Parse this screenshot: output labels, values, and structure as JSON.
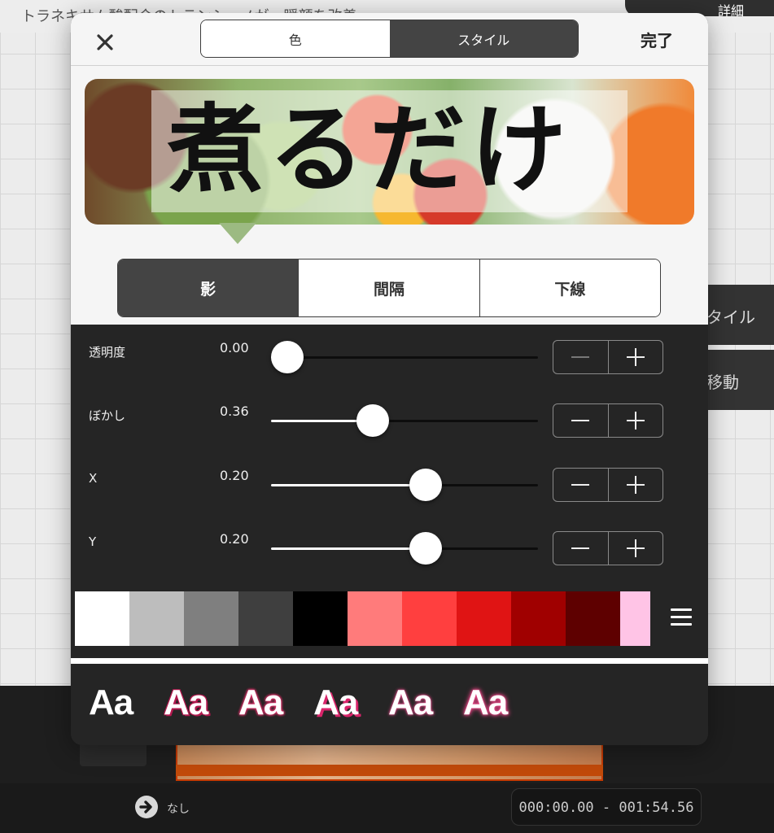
{
  "background": {
    "title": "トラネキサム酸配合のトランシーノが一瞬顔を改善",
    "detail_button": "詳細",
    "side_style_button": "タイル",
    "side_move_button": "移動",
    "transition_label": "なし",
    "time_range": "000:00.00 - 001:54.56"
  },
  "modal": {
    "close_icon": "close-icon",
    "tabs": [
      {
        "label": "色",
        "selected": false
      },
      {
        "label": "スタイル",
        "selected": true
      }
    ],
    "done_label": "完了",
    "preview_text": "煮るだけ",
    "sub_tabs": [
      {
        "label": "影",
        "selected": true
      },
      {
        "label": "間隔",
        "selected": false
      },
      {
        "label": "下線",
        "selected": false
      }
    ],
    "sliders": [
      {
        "label": "透明度",
        "value_text": "0.00",
        "fraction": 0.06
      },
      {
        "label": "ぼかし",
        "value_text": "0.36",
        "fraction": 0.38
      },
      {
        "label": "X",
        "value_text": "0.20",
        "fraction": 0.58
      },
      {
        "label": "Y",
        "value_text": "0.20",
        "fraction": 0.58
      }
    ],
    "palette": [
      "#ffffff",
      "#bdbdbd",
      "#7f7f7f",
      "#3f3f3f",
      "#000000",
      "#ff7b7b",
      "#ff3f3f",
      "#e01414",
      "#a00000",
      "#5e0000",
      "#ffc4e6"
    ],
    "palette_menu_icon": "hamburger-icon",
    "presets": [
      "Aa",
      "Aa",
      "Aa",
      "Aa",
      "Aa",
      "Aa"
    ],
    "colors": {
      "accent_dark": "#444444",
      "panel": "#252525"
    }
  }
}
